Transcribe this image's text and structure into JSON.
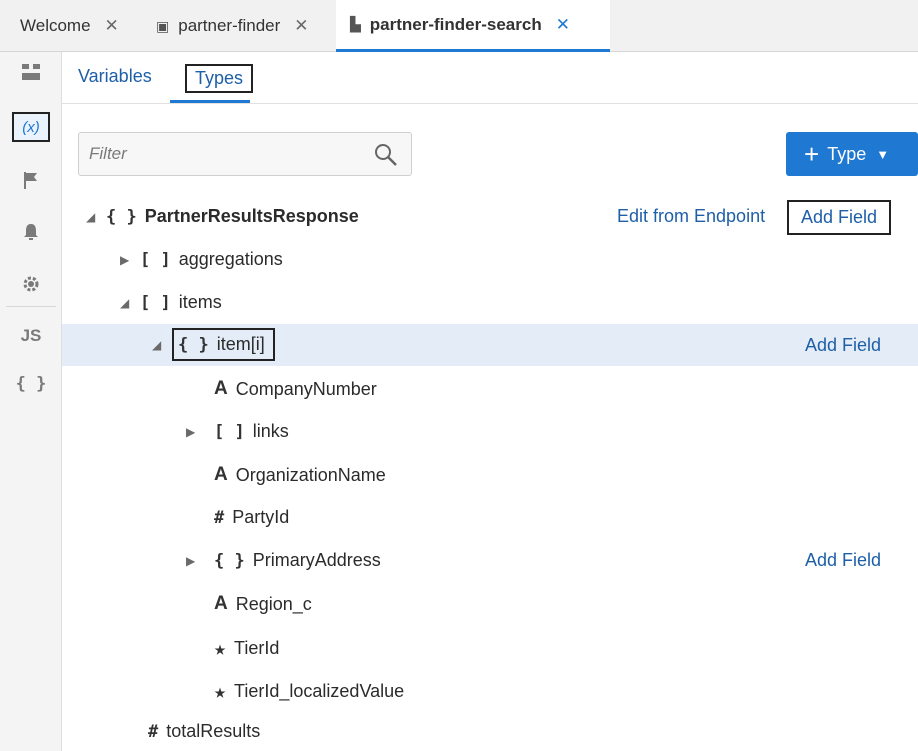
{
  "tabs": [
    {
      "label": "Welcome",
      "close": "✕"
    },
    {
      "label": "partner-finder",
      "close": "✕"
    },
    {
      "label": "partner-finder-search",
      "close": "✕"
    }
  ],
  "subtabs": {
    "variables": "Variables",
    "types": "Types"
  },
  "rail": {
    "vars_icon": "(x)",
    "js_icon": "JS",
    "json_icon": "{ }"
  },
  "filter": {
    "placeholder": "Filter",
    "value": ""
  },
  "type_button": {
    "plus": "+",
    "label": "Type",
    "caret": "▼"
  },
  "tree": {
    "root": {
      "symbol": "{ }",
      "label": "PartnerResultsResponse",
      "edit_link": "Edit from Endpoint",
      "add_link": "Add Field"
    },
    "aggregations": {
      "symbol": "[ ]",
      "label": "aggregations"
    },
    "items": {
      "symbol": "[ ]",
      "label": "items"
    },
    "item": {
      "symbol": "{ }",
      "label": "item[i]",
      "add_link": "Add Field"
    },
    "company_number": {
      "symbol": "A",
      "label": "CompanyNumber"
    },
    "links": {
      "symbol": "[ ]",
      "label": "links"
    },
    "organization_name": {
      "symbol": "A",
      "label": "OrganizationName"
    },
    "party_id": {
      "symbol": "#",
      "label": "PartyId"
    },
    "primary_address": {
      "symbol": "{ }",
      "label": "PrimaryAddress",
      "add_link": "Add Field"
    },
    "region": {
      "symbol": "A",
      "label": "Region_c"
    },
    "tier_id": {
      "symbol": "★",
      "label": "TierId"
    },
    "tier_id_localized": {
      "symbol": "★",
      "label": "TierId_localizedValue"
    },
    "total_results": {
      "symbol": "#",
      "label": "totalResults"
    }
  },
  "colors": {
    "accent": "#1f78d1",
    "link": "#1e5fa8",
    "selected_row": "#e4edf7"
  }
}
